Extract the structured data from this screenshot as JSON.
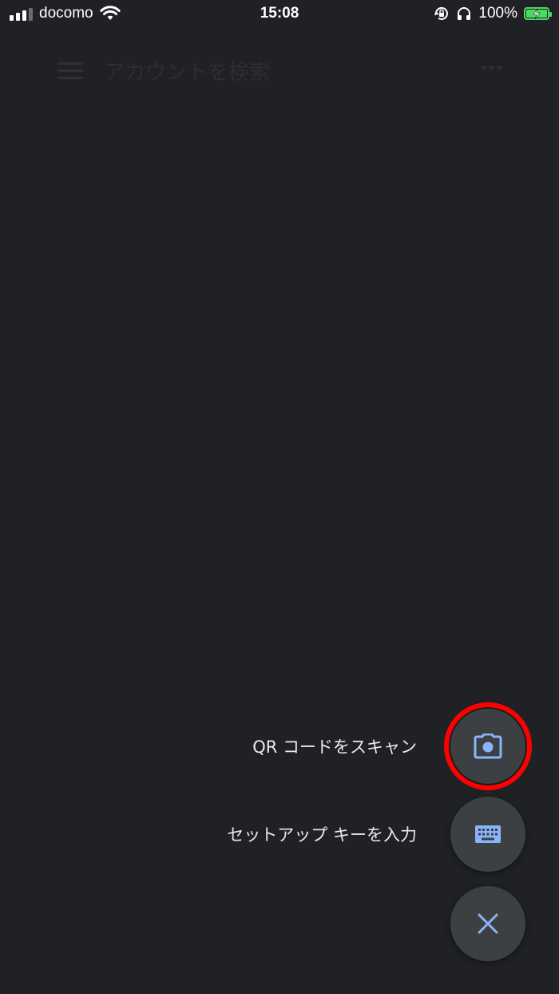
{
  "status_bar": {
    "carrier": "docomo",
    "time": "15:08",
    "battery_percent": "100%",
    "battery_level": 1.0,
    "signal_bars": 3
  },
  "toolbar": {
    "search_placeholder": "アカウントを検索",
    "menu_icon": "hamburger-menu-icon",
    "more_icon": "more-horizontal-icon"
  },
  "fab_menu": {
    "scan_qr_label": "QR コードをスキャン",
    "scan_qr_icon": "camera-icon",
    "enter_key_label": "セットアップ キーを入力",
    "enter_key_icon": "keyboard-icon",
    "close_icon": "close-icon"
  },
  "colors": {
    "background": "#202124",
    "fab_background": "#3c4043",
    "icon_accent": "#8ab4f8",
    "highlight_ring": "#ff0000",
    "battery": "#4cd964"
  }
}
